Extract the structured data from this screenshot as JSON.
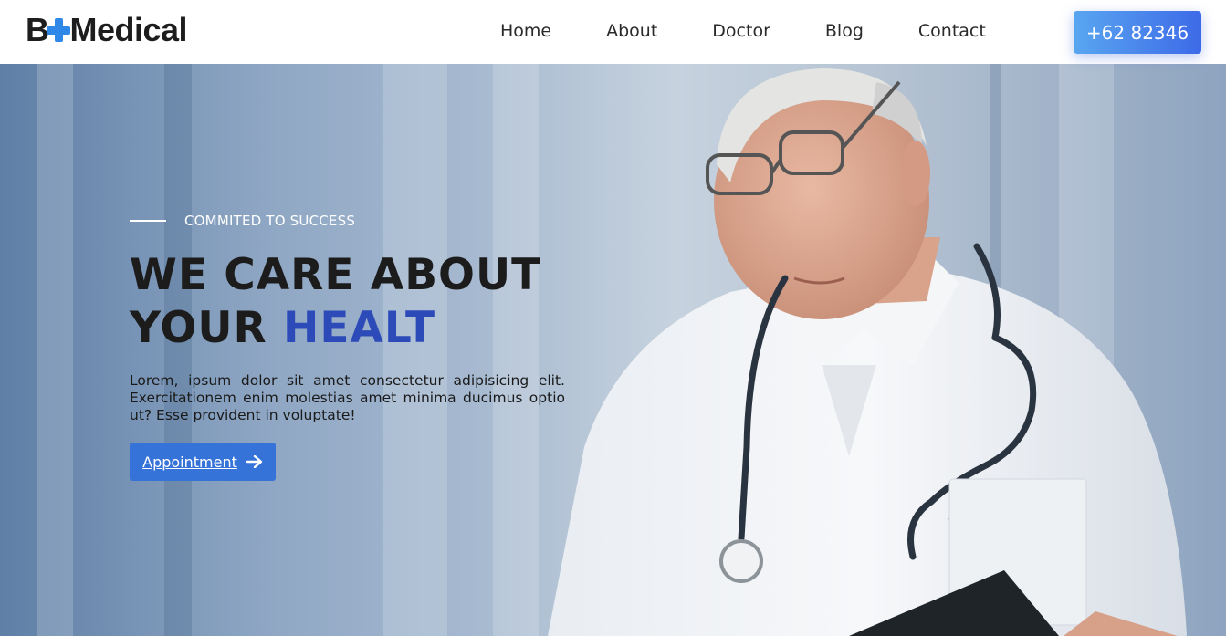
{
  "brand": {
    "logo_left": "B",
    "logo_right": "Medical"
  },
  "nav": {
    "items": [
      "Home",
      "About",
      "Doctor",
      "Blog",
      "Contact"
    ]
  },
  "header": {
    "phone_label": "+62 82346"
  },
  "hero": {
    "tagline": "COMMITED TO SUCCESS",
    "headline_line1": "WE CARE ABOUT",
    "headline_line2_plain": "YOUR ",
    "headline_line2_accent": "HEALT",
    "description": "Lorem, ipsum dolor sit amet consectetur adipisicing elit. Exercitationem enim molestias amet minima ducimus optio ut? Esse provident in voluptate!",
    "button_label": "Appointment"
  },
  "icons": {
    "logo_cross": "plus-cross-icon",
    "button_arrow": "arrow-right-icon"
  },
  "colors": {
    "accent": "#2d4bb8",
    "button": "#3673d8",
    "logo_cross": "#2f87e8",
    "phone_gradient_start": "#59a6f0",
    "phone_gradient_end": "#3d6ae8"
  }
}
